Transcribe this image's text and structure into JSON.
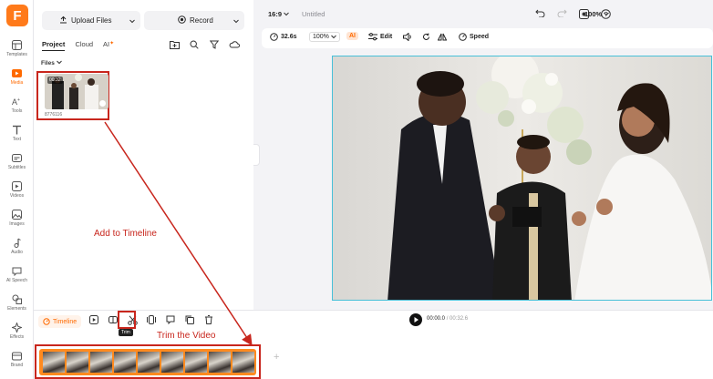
{
  "app": {
    "logo_letter": "F"
  },
  "rail": {
    "items": [
      {
        "label": "Templates",
        "icon": "templates-icon"
      },
      {
        "label": "Media",
        "icon": "media-icon",
        "active": true
      },
      {
        "label": "Tools",
        "icon": "tools-icon"
      },
      {
        "label": "Text",
        "icon": "text-icon"
      },
      {
        "label": "Subtitles",
        "icon": "subtitles-icon"
      },
      {
        "label": "Videos",
        "icon": "videos-icon"
      },
      {
        "label": "Images",
        "icon": "images-icon"
      },
      {
        "label": "Audio",
        "icon": "audio-icon"
      },
      {
        "label": "AI Speech",
        "icon": "ai-speech-icon"
      },
      {
        "label": "Elements",
        "icon": "elements-icon"
      },
      {
        "label": "Effects",
        "icon": "effects-icon"
      },
      {
        "label": "Brand",
        "icon": "brand-icon"
      }
    ]
  },
  "media": {
    "upload_label": "Upload Files",
    "record_label": "Record",
    "tabs": {
      "project": "Project",
      "cloud": "Cloud",
      "ai": "AI"
    },
    "files_label": "Files",
    "thumb": {
      "duration": "00:32",
      "name": "8776116"
    }
  },
  "topbar": {
    "ratio": "16:9",
    "title": "Untitled",
    "zoom": "100%"
  },
  "toolbar": {
    "duration": "32.6s",
    "scale": "100%",
    "ai": "AI",
    "edit": "Edit",
    "speed": "Speed"
  },
  "timeline": {
    "label": "Timeline",
    "trim_tooltip": "Trim",
    "current_time": "00:00.0",
    "total_time": "/ 00:32.6",
    "add_symbol": "+"
  },
  "annotations": {
    "add_to_timeline": "Add to Timeline",
    "trim_the_video": "Trim the Video",
    "color": "#c8261d"
  },
  "colors": {
    "accent": "#ff6a00",
    "track": "#ff8a1f",
    "selection": "#47c0d8"
  }
}
